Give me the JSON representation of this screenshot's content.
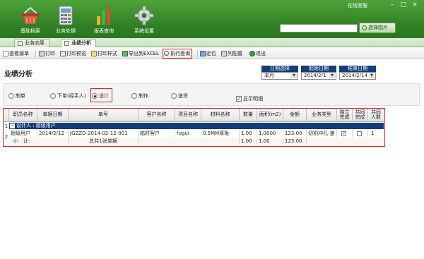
{
  "app": {
    "online_service": "在线客服",
    "window_controls": [
      "–",
      "□",
      "×"
    ]
  },
  "nav": [
    {
      "label": "基础档案",
      "icon": "basket-icon"
    },
    {
      "label": "业务处理",
      "icon": "calculator-icon"
    },
    {
      "label": "报表查询",
      "icon": "bar-chart-icon"
    },
    {
      "label": "系统设置",
      "icon": "gear-icon"
    }
  ],
  "search": {
    "value": "",
    "button_label": "选择图片"
  },
  "tabs": [
    {
      "label": "业务向导",
      "active": false
    },
    {
      "label": "业绩分析",
      "active": true
    }
  ],
  "toolbar": {
    "view_docs": "查看源单",
    "print": "打印",
    "print_preview": "打印预览",
    "print_style": "打印样式",
    "export_excel": "导出到EXCEL",
    "execute_query": "执行查询",
    "locate": "定位",
    "column_config": "列配置",
    "exit": "退出"
  },
  "page": {
    "title": "业绩分析"
  },
  "dates": {
    "date_select_label": "日期选择",
    "date_select_value": "本月",
    "start_label": "起始日期",
    "start_value": "2014/2/1",
    "end_label": "结束日期",
    "end_value": "2014/2/14"
  },
  "radios": [
    {
      "label": "制单",
      "selected": false
    },
    {
      "label": "下单(经手人)",
      "selected": false
    },
    {
      "label": "设计",
      "selected": true
    },
    {
      "label": "制作",
      "selected": false
    },
    {
      "label": "送货",
      "selected": false
    }
  ],
  "show_detail": {
    "label": "显示明细",
    "checked": true
  },
  "grid": {
    "columns": [
      "职员名称",
      "单据日期",
      "单号",
      "客户名称",
      "项目名称",
      "材料名称",
      "数量",
      "面积(m2)",
      "金额",
      "业务类型",
      "独立\n完成",
      "共同\n完成",
      "共同\n人数"
    ],
    "row_numbers": [
      "1",
      "2"
    ],
    "group_label": "设计人 : 超级用户",
    "rows": [
      {
        "employee": "超级用户",
        "date": "2014/2/12",
        "doc_no": "JGZZD-2014-02-12-001",
        "customer": "临时客户",
        "project": "fugui",
        "material": "0.5MM厚板",
        "qty": "1.00",
        "area": "1.0000",
        "amount": "123.00",
        "biz_type": "切割冲孔-速",
        "independent": true,
        "joint": false,
        "joint_count": "1"
      }
    ],
    "summary": {
      "label": "小　计:",
      "doc_count": "总共1张单据",
      "qty": "1.00",
      "area": "1.00",
      "amount": "123.00"
    }
  },
  "colors": {
    "header_green": "#2f7f23",
    "group_navy": "#123e7a",
    "highlight_red": "#e02020"
  }
}
